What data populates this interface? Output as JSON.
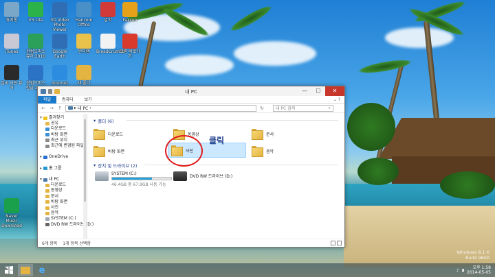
{
  "window": {
    "title": "내 PC",
    "minimize": "—",
    "maximize": "☐",
    "close": "✕"
  },
  "ribbon": {
    "tabs": [
      "파일",
      "컴퓨터",
      "보기"
    ]
  },
  "address": {
    "back": "←",
    "forward": "→",
    "up": "↑",
    "path_root": "▸",
    "path": "내 PC",
    "path_sep": "›",
    "search_placeholder": "내 PC 검색"
  },
  "nav": {
    "items": [
      {
        "label": "즐겨찾기",
        "indent": 0,
        "color": "#f0c419",
        "expander": "▾"
      },
      {
        "label": "공유",
        "indent": 1,
        "color": "#e8b84a"
      },
      {
        "label": "다운로드",
        "indent": 1,
        "color": "#3a8fd6"
      },
      {
        "label": "바탕 화면",
        "indent": 1,
        "color": "#3a8fd6"
      },
      {
        "label": "최근 위치",
        "indent": 1,
        "color": "#8a8a8a"
      },
      {
        "label": "최근에 변경된 파일",
        "indent": 1,
        "color": "#8a8a8a"
      },
      {
        "label": "",
        "indent": 0,
        "color": "transparent"
      },
      {
        "label": "OneDrive",
        "indent": 0,
        "color": "#2a6fd1",
        "expander": "▸"
      },
      {
        "label": "",
        "indent": 0,
        "color": "transparent"
      },
      {
        "label": "홈 그룹",
        "indent": 0,
        "color": "#2a9ad6",
        "expander": "▸"
      },
      {
        "label": "",
        "indent": 0,
        "color": "transparent"
      },
      {
        "label": "내 PC",
        "indent": 0,
        "color": "#4a7ba8",
        "expander": "▾"
      },
      {
        "label": "다운로드",
        "indent": 1,
        "color": "#e4b442"
      },
      {
        "label": "동영상",
        "indent": 1,
        "color": "#e4b442"
      },
      {
        "label": "문서",
        "indent": 1,
        "color": "#e4b442"
      },
      {
        "label": "바탕 화면",
        "indent": 1,
        "color": "#e4b442"
      },
      {
        "label": "사진",
        "indent": 1,
        "color": "#e4b442"
      },
      {
        "label": "음악",
        "indent": 1,
        "color": "#e4b442"
      },
      {
        "label": "SYSTEM (C:)",
        "indent": 1,
        "color": "#9aa6b2"
      },
      {
        "label": "DVD RW 드라이브 (D:)",
        "indent": 1,
        "color": "#666666"
      }
    ]
  },
  "content": {
    "folders_header": "폴더 (6)",
    "folders": [
      {
        "label": "다운로드"
      },
      {
        "label": "동영상"
      },
      {
        "label": "문서"
      },
      {
        "label": "바탕 화면"
      },
      {
        "label": "사진"
      },
      {
        "label": "음악"
      }
    ],
    "devices_header": "장치 및 드라이브 (2)",
    "drives": [
      {
        "label": "SYSTEM (C:)",
        "free": "46.4GB 중 67.9GB 사용 가능",
        "fill": 0.68
      },
      {
        "label": "DVD RW 드라이브 (D:)"
      }
    ]
  },
  "status": {
    "count": "6개 항목",
    "selected": "1개 항목 선택함"
  },
  "annotation": {
    "text": "클릭",
    "color": "#e0191a"
  },
  "desktop_icons": [
    {
      "label": "휴지통",
      "color": "#7aa6c8"
    },
    {
      "label": "V3 Lite",
      "color": "#2bb34a"
    },
    {
      "label": "3D Video Photo Viewer",
      "color": "#2f6db5"
    },
    {
      "label": "Hancom Office",
      "color": "#4a90c8"
    },
    {
      "label": "알약",
      "color": "#d23a3a"
    },
    {
      "label": "Faxcon",
      "color": "#e6a11a"
    },
    {
      "label": "iTunes",
      "color": "#c9c9d6"
    },
    {
      "label": "한컴오피스 뷰어 2010",
      "color": "#2aa05a"
    },
    {
      "label": "Google Earth",
      "color": "#2f6db5"
    },
    {
      "label": "반디캠",
      "color": "#e8c24a"
    },
    {
      "label": "BreadCrumbs",
      "color": "#f2f2f2"
    },
    {
      "label": "크롬 바로가기",
      "color": "#d93a2b"
    },
    {
      "label": "알씨 사진 뷰어",
      "color": "#2a2a2a"
    },
    {
      "label": "한컴오피스 한글 2010",
      "color": "#2a73c5"
    },
    {
      "label": "Internet Explorer",
      "color": "#2b8ce0"
    },
    {
      "label": "새 폴더",
      "color": "#e4b442"
    },
    {
      "label": "Naver Music Download",
      "color": "#1aa04a"
    }
  ],
  "taskbar": {
    "clock_time": "오후 1:58",
    "clock_date": "2014-05-05"
  },
  "watermark": {
    "line1": "Windows 8.1 K",
    "line2": "Build 9600"
  }
}
